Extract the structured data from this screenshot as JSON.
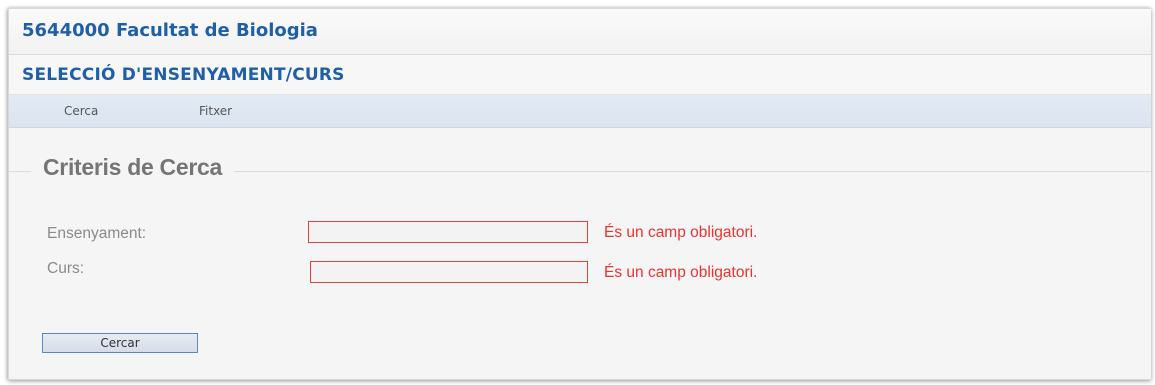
{
  "header": {
    "faculty_title": "5644000 Facultat de Biologia",
    "page_title": "SELECCIÓ D'ENSENYAMENT/CURS"
  },
  "menu": {
    "items": [
      {
        "label": "Cerca"
      },
      {
        "label": "Fitxer"
      }
    ]
  },
  "search_form": {
    "legend": "Criteris de Cerca",
    "fields": [
      {
        "label": "Ensenyament:",
        "value": "",
        "error": "És un camp obligatori."
      },
      {
        "label": "Curs:",
        "value": "",
        "error": "És un camp obligatori."
      }
    ],
    "submit_label": "Cercar"
  },
  "colors": {
    "title_blue": "#1f5fa8",
    "menubar_bg": "#dbe4f0",
    "error_red": "#e8332e",
    "field_border": "#e04040",
    "button_border": "#5b86c4"
  }
}
